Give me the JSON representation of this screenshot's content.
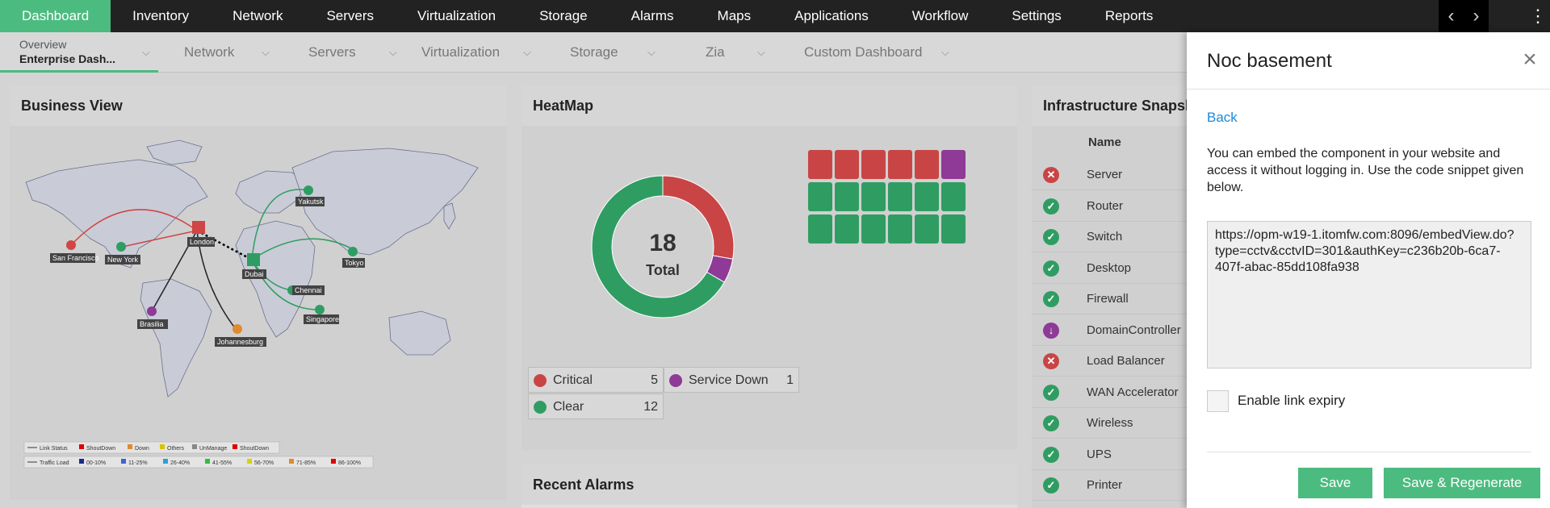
{
  "topnav": {
    "items": [
      "Dashboard",
      "Inventory",
      "Network",
      "Servers",
      "Virtualization",
      "Storage",
      "Alarms",
      "Maps",
      "Applications",
      "Workflow",
      "Settings",
      "Reports"
    ],
    "active_index": 0
  },
  "subnav": {
    "overview_line1": "Overview",
    "overview_line2": "Enterprise Dash...",
    "tabs": [
      "Network",
      "Servers",
      "Virtualization",
      "Storage",
      "Zia",
      "Custom Dashboard"
    ]
  },
  "business_view": {
    "title": "Business View",
    "cities": [
      "San Francisco",
      "New York",
      "London",
      "Yakutsk",
      "Tokyo",
      "Dubai",
      "Chennai",
      "Singapore",
      "Brasilia",
      "Johannesburg"
    ],
    "legend_row1": [
      "Link Status",
      "ShoutDown",
      "Down",
      "Others",
      "UnManage",
      "ShoutDown"
    ],
    "legend_row2": [
      "Traffic Load",
      "00-10%",
      "11-25%",
      "26-40%",
      "41-55%",
      "56-70%",
      "71-85%",
      "86-100%"
    ]
  },
  "heatmap": {
    "title": "HeatMap",
    "total_value": "18",
    "total_label": "Total",
    "legend": [
      {
        "label": "Critical",
        "count": "5",
        "color": "#c94545"
      },
      {
        "label": "Service Down",
        "count": "1",
        "color": "#8e3a96"
      },
      {
        "label": "Clear",
        "count": "12",
        "color": "#2f9d62"
      }
    ],
    "grid": [
      "critical",
      "critical",
      "critical",
      "critical",
      "critical",
      "down",
      "clear",
      "clear",
      "clear",
      "clear",
      "clear",
      "clear",
      "clear",
      "clear",
      "clear",
      "clear",
      "clear",
      "clear"
    ]
  },
  "recent_alarms": {
    "title": "Recent Alarms"
  },
  "snapshot": {
    "title": "Infrastructure Snapshot",
    "column_name": "Name",
    "rows": [
      {
        "name": "Server",
        "status": "critical"
      },
      {
        "name": "Router",
        "status": "clear"
      },
      {
        "name": "Switch",
        "status": "clear"
      },
      {
        "name": "Desktop",
        "status": "clear"
      },
      {
        "name": "Firewall",
        "status": "clear"
      },
      {
        "name": "DomainController",
        "status": "down"
      },
      {
        "name": "Load Balancer",
        "status": "critical"
      },
      {
        "name": "WAN Accelerator",
        "status": "clear"
      },
      {
        "name": "Wireless",
        "status": "clear"
      },
      {
        "name": "UPS",
        "status": "clear"
      },
      {
        "name": "Printer",
        "status": "clear"
      }
    ]
  },
  "drawer": {
    "title": "Noc basement",
    "back_label": "Back",
    "description": "You can embed the component in your website and access it without logging in. Use the code snippet given below.",
    "embed_url": "https://opm-w19-1.itomfw.com:8096/embedView.do?type=cctv&cctvID=301&authKey=c236b20b-6ca7-407f-abac-85dd108fa938",
    "expiry_label": "Enable link expiry",
    "save_label": "Save",
    "save_regen_label": "Save & Regenerate"
  },
  "colors": {
    "accent": "#4cbb7f",
    "critical": "#c94545",
    "down": "#8e3a96",
    "clear": "#2f9d62",
    "link": "#1e88d8"
  }
}
